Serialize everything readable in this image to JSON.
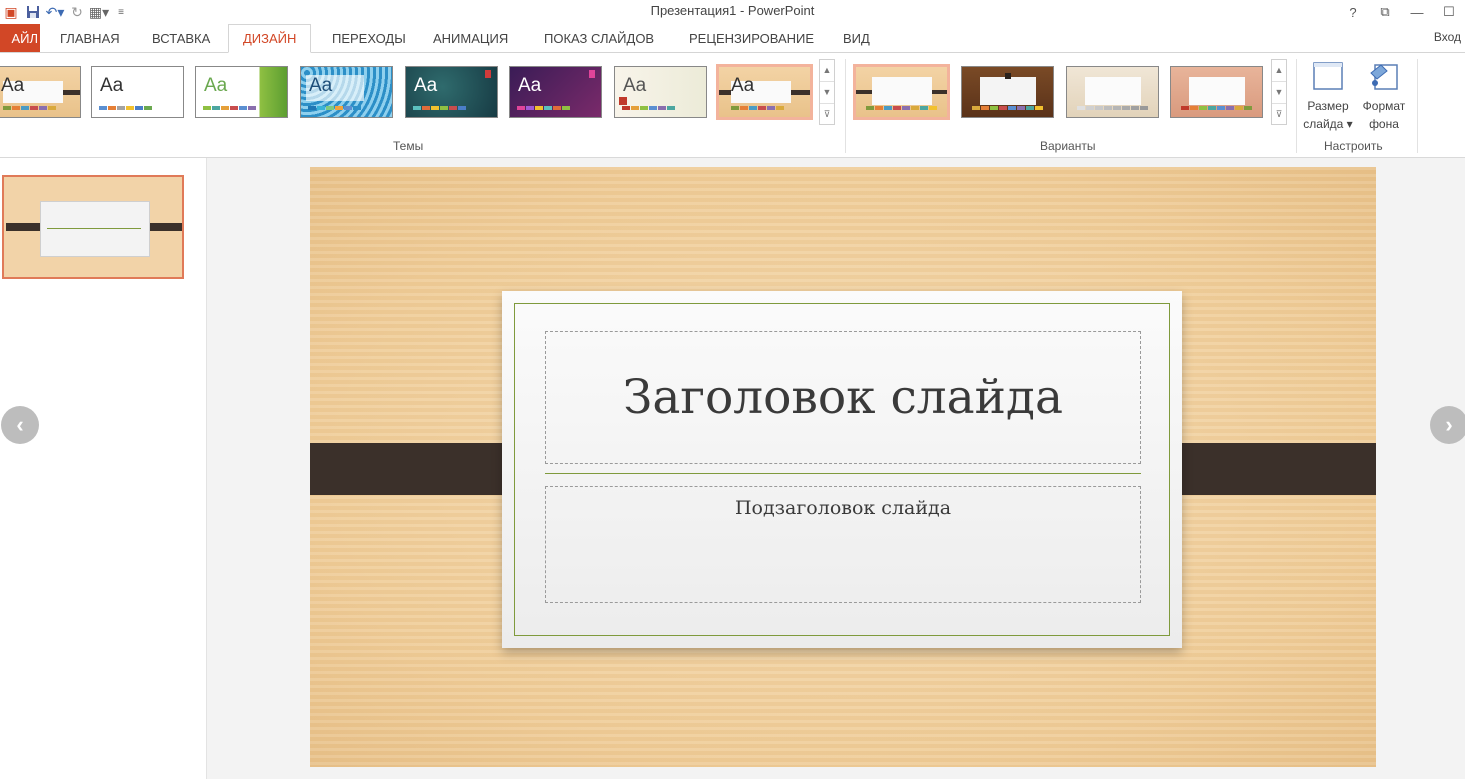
{
  "window": {
    "title": "Презентация1 - PowerPoint",
    "controls": [
      "?",
      "⧉",
      "—",
      "☐"
    ]
  },
  "tabs": {
    "file": "АЙЛ",
    "items": [
      "ГЛАВНАЯ",
      "ВСТАВКА",
      "ДИЗАЙН",
      "ПЕРЕХОДЫ",
      "АНИМАЦИЯ",
      "ПОКАЗ СЛАЙДОВ",
      "РЕЦЕНЗИРОВАНИЕ",
      "ВИД"
    ],
    "active": "ДИЗАЙН",
    "signin": "Вход"
  },
  "ribbon": {
    "themes_label": "Темы",
    "variants_label": "Варианты",
    "customize_label": "Настроить",
    "theme_aa": "Aa",
    "slide_size": {
      "line1": "Размер",
      "line2": "слайда ▾"
    },
    "format_bg": {
      "line1": "Формат",
      "line2": "фона"
    }
  },
  "slide": {
    "title": "Заголовок слайда",
    "subtitle": "Подзаголовок слайда"
  },
  "colors": {
    "accent": "#d24726",
    "wood": "#efcc97",
    "band": "#3b302a",
    "frame_green": "#7f9a3c"
  }
}
